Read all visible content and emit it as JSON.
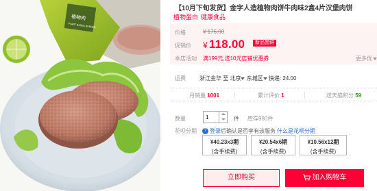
{
  "product": {
    "title": "【10月下旬发货】金字人造植物肉饼牛肉味2盒4片汉堡肉饼",
    "subtitle_tags": [
      "植物蛋白",
      "健康食品"
    ],
    "package_text_cn": "植物肉",
    "package_text_en": "PLANT BASED BURGER"
  },
  "pricing": {
    "orig_label": "价格",
    "orig_price": "¥ 176.00",
    "promo_label": "促销价",
    "currency": "¥",
    "price": "118.00",
    "badge": "新品尝鲜",
    "activity_label": "本店活动",
    "activity_text": "满199元,送10元店铺优惠券",
    "more_text": "更多优"
  },
  "shipping": {
    "label": "运费",
    "from": "浙江金华",
    "to_word": "至",
    "dest": "北京",
    "district": "东城区",
    "fee": "快递: 24.00"
  },
  "stats": {
    "monthly_label": "月销量",
    "monthly_value": "1001",
    "reviews_label": "累计评价",
    "reviews_value": "1",
    "points_label": "送天猫积分",
    "points_value": "59"
  },
  "quantity": {
    "label": "数量",
    "value": "1",
    "unit": "件",
    "stock": "库存980件"
  },
  "huabei": {
    "label": "花呗分期",
    "login_link": "登录",
    "info_text": "后确认是否享有该服务",
    "what_link": "什么是花呗分期",
    "plans": [
      {
        "line1": "¥40.23x3期",
        "line2": "(含手续费)"
      },
      {
        "line1": "¥20.54x6期",
        "line2": "(含手续费)"
      },
      {
        "line1": "¥10.56x12期",
        "line2": "(含手续费)"
      }
    ]
  },
  "actions": {
    "buy_now": "立即购买",
    "add_cart": "加入购物车"
  },
  "colors": {
    "brand_red": "#ff0036",
    "price_bg": "#fef3f3",
    "link_blue": "#2470d8",
    "points_green": "#2b9612"
  }
}
